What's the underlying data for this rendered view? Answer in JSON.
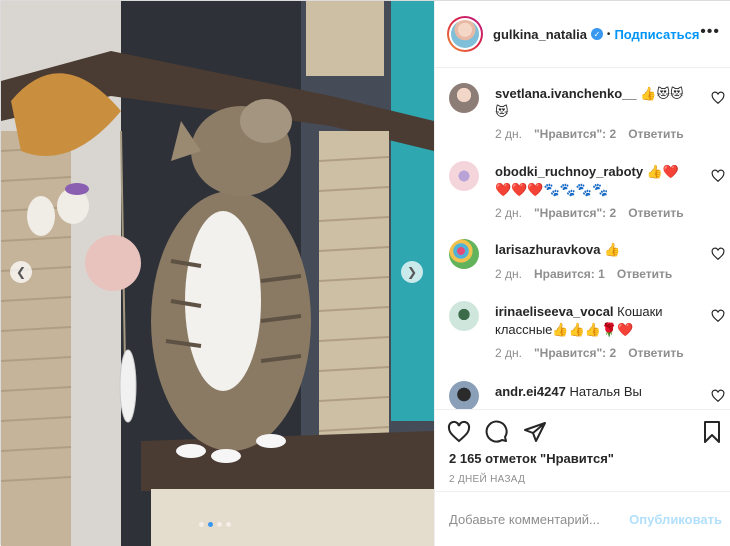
{
  "header": {
    "username": "gulkina_natalia",
    "separator": "•",
    "follow_label": "Подписаться",
    "more_label": "•••"
  },
  "comments": [
    {
      "username": "svetlana.ivanchenko__",
      "text": " 👍😻😻😻",
      "time": "2 дн.",
      "likes": "\"Нравится\": 2",
      "reply": "Ответить"
    },
    {
      "username": "obodki_ruchnoy_raboty",
      "text": " 👍❤️❤️❤️❤️🐾🐾🐾🐾",
      "time": "2 дн.",
      "likes": "\"Нравится\": 2",
      "reply": "Ответить"
    },
    {
      "username": "larisazhuravkova",
      "text": " 👍",
      "time": "2 дн.",
      "likes": "Нравится: 1",
      "reply": "Ответить"
    },
    {
      "username": "irinaeliseeva_vocal",
      "text": " Кошаки классные👍👍👍🌹❤️",
      "time": "2 дн.",
      "likes": "\"Нравится\": 2",
      "reply": "Ответить"
    },
    {
      "username": "andr.ei4247",
      "text": " Наталья Вы",
      "time": "",
      "likes": "",
      "reply": ""
    }
  ],
  "stats": {
    "likes_text": "2 165 отметок \"Нравится\"",
    "date_text": "2 ДНЕЙ НАЗАД"
  },
  "add_comment": {
    "placeholder": "Добавьте комментарий...",
    "publish_label": "Опубликовать"
  },
  "carousel": {
    "dot_count": 4,
    "active_index": 1
  },
  "colors": {
    "accent": "#0095f6",
    "verified": "#3897f0",
    "muted": "#8e8e8e"
  }
}
